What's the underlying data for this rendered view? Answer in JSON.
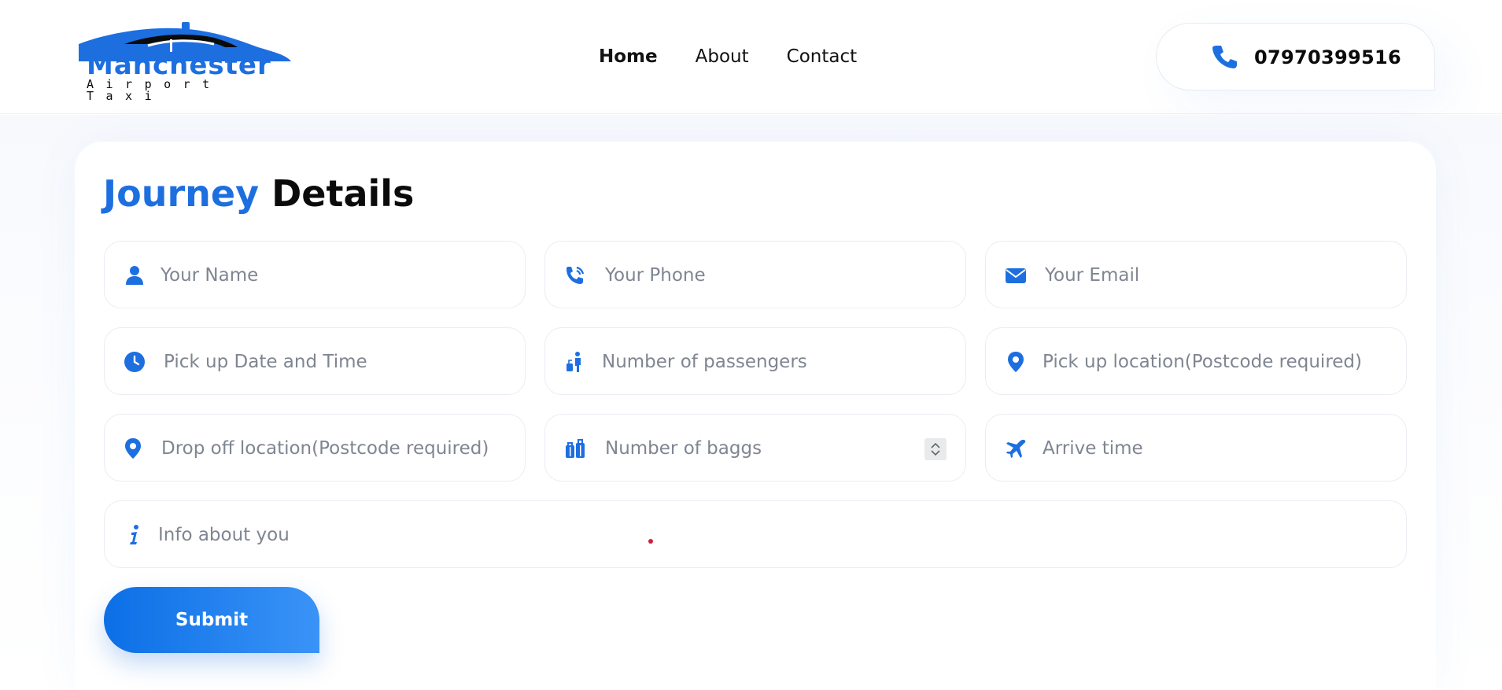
{
  "brand": {
    "name": "Manchester",
    "tagline": "Airport Taxi",
    "color": "#1d6fe0"
  },
  "nav": {
    "items": [
      {
        "label": "Home",
        "active": true
      },
      {
        "label": "About",
        "active": false
      },
      {
        "label": "Contact",
        "active": false
      }
    ]
  },
  "header": {
    "phone": "07970399516",
    "phone_icon": "phone-icon"
  },
  "form": {
    "title_highlight": "Journey",
    "title_rest": "Details",
    "fields": {
      "name": {
        "placeholder": "Your Name",
        "icon": "user-icon"
      },
      "phone": {
        "placeholder": "Your Phone",
        "icon": "phone-ringing-icon"
      },
      "email": {
        "placeholder": "Your Email",
        "icon": "envelope-icon"
      },
      "pickup_time": {
        "placeholder": "Pick up Date and Time",
        "icon": "clock-icon"
      },
      "passengers": {
        "placeholder": "Number of passengers",
        "icon": "traveler-icon"
      },
      "pickup_location": {
        "placeholder": "Pick up location(Postcode required)",
        "icon": "map-pin-icon"
      },
      "dropoff_location": {
        "placeholder": "Drop off location(Postcode required)",
        "icon": "map-pin-icon"
      },
      "bags": {
        "placeholder": "Number of baggs",
        "icon": "suitcase-icon"
      },
      "arrive_time": {
        "placeholder": "Arrive time",
        "icon": "plane-icon"
      },
      "info": {
        "placeholder": "Info about you",
        "icon": "info-icon"
      }
    },
    "submit_label": "Submit"
  },
  "colors": {
    "accent": "#1d6fe0",
    "placeholder": "#7f8591",
    "border": "#e9edf3"
  }
}
